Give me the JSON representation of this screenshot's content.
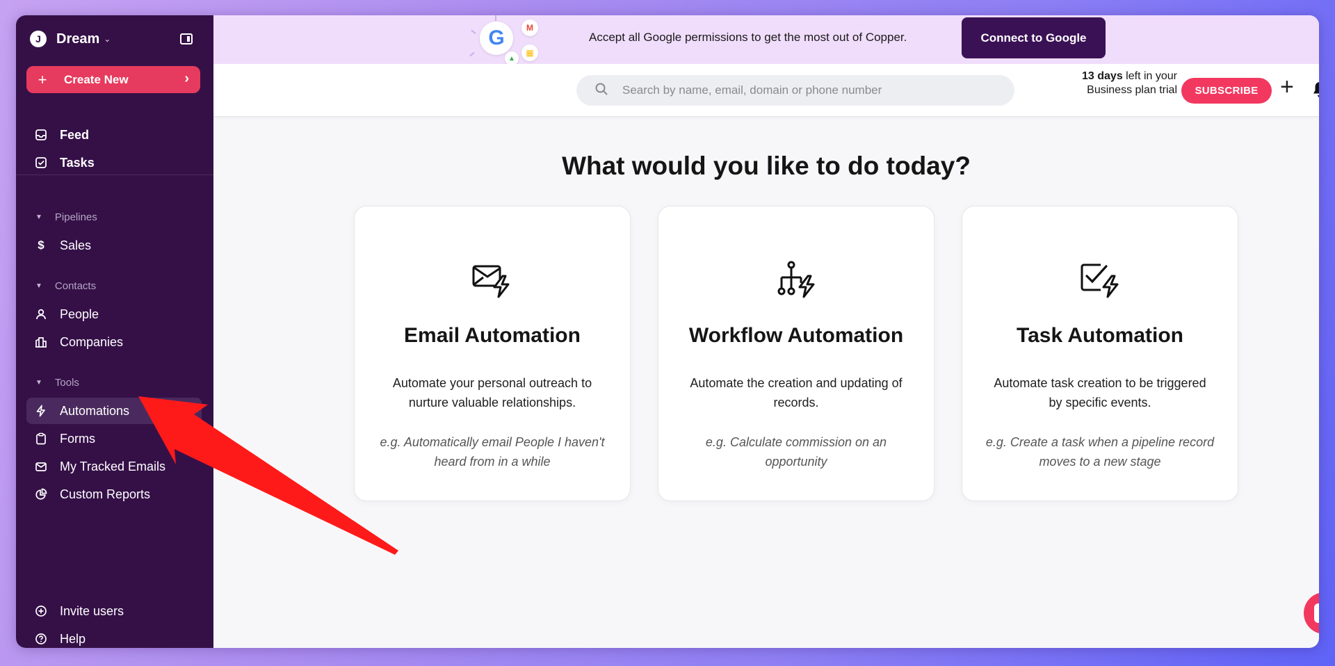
{
  "sidebar": {
    "workspace_initial": "J",
    "workspace_name": "Dream",
    "create_new": "Create New",
    "feed": "Feed",
    "tasks": "Tasks",
    "pipelines_head": "Pipelines",
    "sales": "Sales",
    "contacts_head": "Contacts",
    "people": "People",
    "companies": "Companies",
    "tools_head": "Tools",
    "automations": "Automations",
    "forms": "Forms",
    "tracked_emails": "My Tracked Emails",
    "custom_reports": "Custom Reports",
    "invite_users": "Invite users",
    "help": "Help"
  },
  "banner": {
    "text": "Accept all Google permissions to get the most out of Copper.",
    "connect_button": "Connect to Google"
  },
  "topbar": {
    "search_placeholder": "Search by name, email, domain or phone number",
    "trial_days": "13 days",
    "trial_rest": " left in your Business plan trial",
    "subscribe": "SUBSCRIBE"
  },
  "main": {
    "headline": "What would you like to do today?",
    "cards": [
      {
        "title": "Email Automation",
        "description": "Automate your personal outreach to nurture valuable relationships.",
        "example": "e.g. Automatically email People I haven't heard from in a while"
      },
      {
        "title": "Workflow Automation",
        "description": "Automate the creation and updating of records.",
        "example": "e.g. Calculate commission on an opportunity"
      },
      {
        "title": "Task Automation",
        "description": "Automate task creation to be triggered by specific events.",
        "example": "e.g. Create a task when a pipeline record moves to a new stage"
      }
    ]
  },
  "colors": {
    "sidebar_bg": "#351047",
    "accent_pink": "#f2385f",
    "connect_btn": "#3b1156",
    "banner_bg": "#f0ddfc",
    "arrow_red": "#ff1a1a"
  }
}
